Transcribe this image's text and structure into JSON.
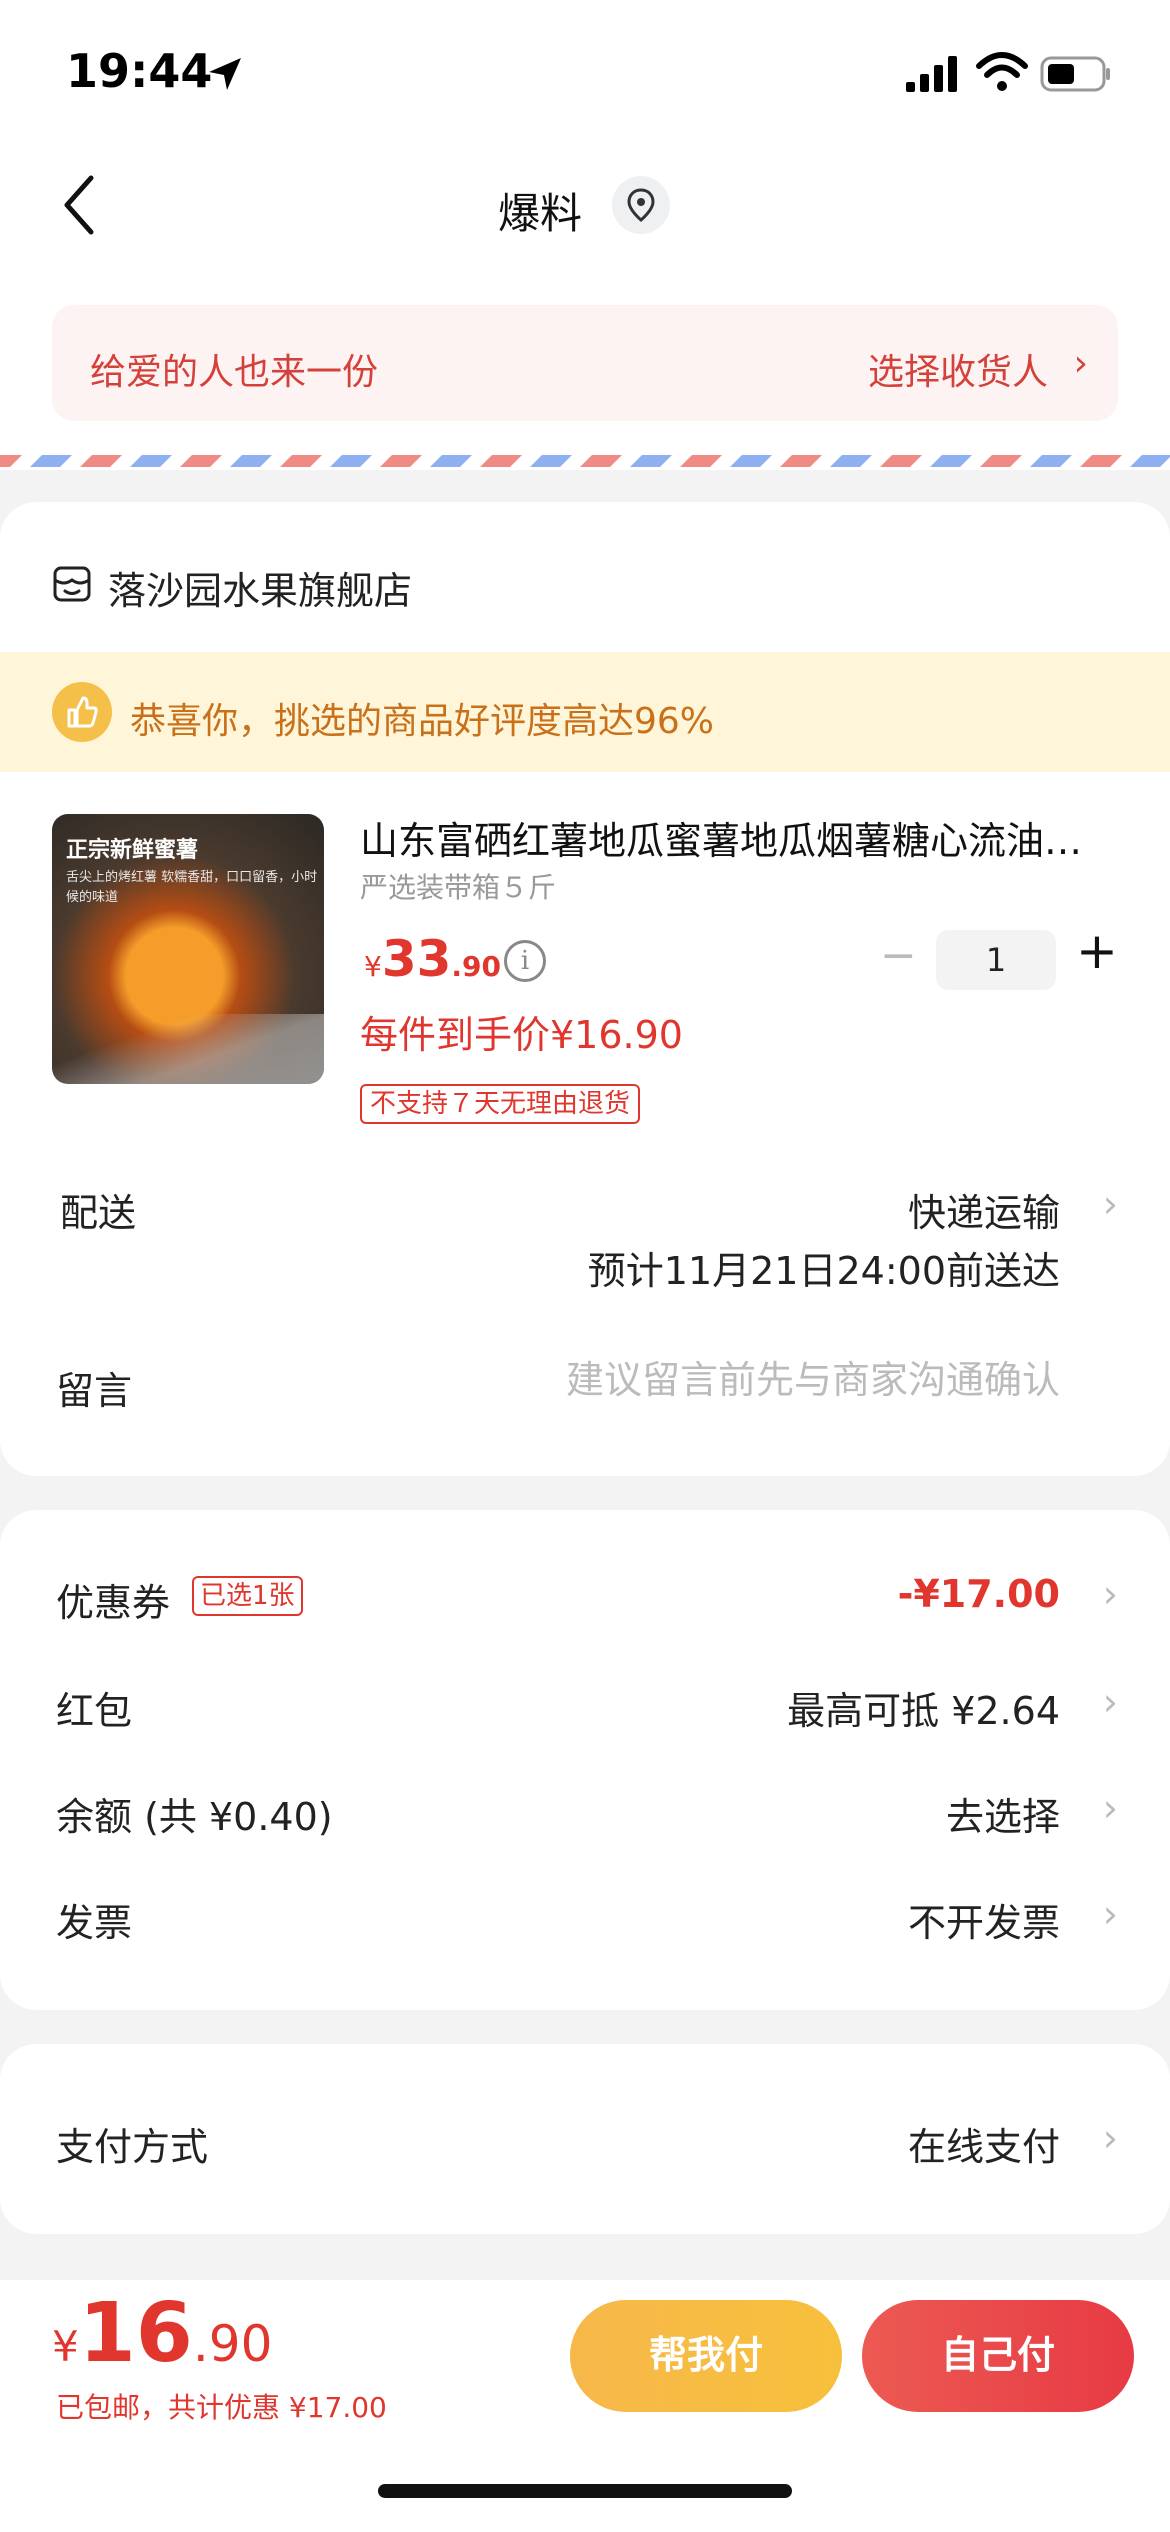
{
  "status": {
    "time": "19:44"
  },
  "nav": {
    "title": "爆料"
  },
  "gift": {
    "left_text": "给爱的人也来一份",
    "right_text": "选择收货人",
    "chevron": "›"
  },
  "store": {
    "name": "落沙园水果旗舰店",
    "icon": "store-icon"
  },
  "promo": {
    "text": "恭喜你，挑选的商品好评度高达96%",
    "icon": "thumbs-up-icon"
  },
  "product": {
    "image_tag": "正宗新鲜蜜薯",
    "image_sub": "舌尖上的烤红薯 软糯香甜，口口留香，小时候的味道",
    "title": "山东富硒红薯地瓜蜜薯地瓜烟薯糖心流油…",
    "spec": "严选装带箱５斤",
    "price_yen": "¥",
    "price_int": "33",
    "price_dec": ".90",
    "quantity": "1",
    "minus": "−",
    "plus": "+",
    "unit_price": "每件到手价¥16.90",
    "no_return": "不支持７天无理由退货"
  },
  "delivery": {
    "label": "配送",
    "value": "快递运输",
    "eta": "预计11月21日24:00前送达"
  },
  "message": {
    "label": "留言",
    "placeholder": "建议留言前先与商家沟通确认"
  },
  "discounts": {
    "coupon_label": "优惠券",
    "coupon_tag": "已选1张",
    "coupon_value": "-¥17.00",
    "redpacket_label": "红包",
    "redpacket_value": "最高可抵 ¥2.64",
    "balance_label": "余额 (共 ¥0.40)",
    "balance_value": "去选择",
    "invoice_label": "发票",
    "invoice_value": "不开发票",
    "chevron": "›"
  },
  "payment": {
    "label": "支付方式",
    "value": "在线支付"
  },
  "footer": {
    "yen": "¥",
    "total_int": "16",
    "total_dec": ".90",
    "summary": "已包邮，共计优惠 ¥17.00",
    "help_pay": "帮我付",
    "self_pay": "自己付"
  },
  "colors": {
    "accent": "#e0362e",
    "promo_bg": "#fff6d9",
    "help_btn": "#f7b84a",
    "self_btn": "#e73a44"
  }
}
